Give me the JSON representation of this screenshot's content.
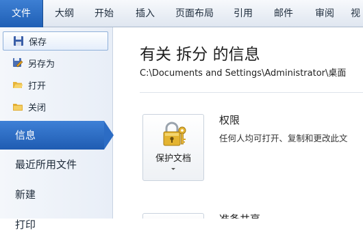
{
  "ribbon": {
    "tabs": [
      {
        "label": "文件"
      },
      {
        "label": "大纲"
      },
      {
        "label": "开始"
      },
      {
        "label": "插入"
      },
      {
        "label": "页面布局"
      },
      {
        "label": "引用"
      },
      {
        "label": "邮件"
      },
      {
        "label": "审阅"
      },
      {
        "label": "视"
      }
    ]
  },
  "nav": {
    "commands": [
      {
        "label": "保存",
        "icon": "save-icon"
      },
      {
        "label": "另存为",
        "icon": "save-as-icon"
      },
      {
        "label": "打开",
        "icon": "open-folder-icon"
      },
      {
        "label": "关闭",
        "icon": "close-folder-icon"
      }
    ],
    "items": [
      {
        "label": "信息"
      },
      {
        "label": "最近所用文件"
      },
      {
        "label": "新建"
      },
      {
        "label": "打印"
      }
    ]
  },
  "main": {
    "title": "有关 拆分 的信息",
    "path": "C:\\Documents and Settings\\Administrator\\桌面",
    "permissions": {
      "button_label": "保护文档",
      "title": "权限",
      "description": "任何人均可打开、复制和更改此文"
    },
    "share": {
      "title": "准备共享"
    }
  },
  "colors": {
    "accent": "#2c6cc4",
    "ribbon_bg": "#e4ebf4"
  }
}
